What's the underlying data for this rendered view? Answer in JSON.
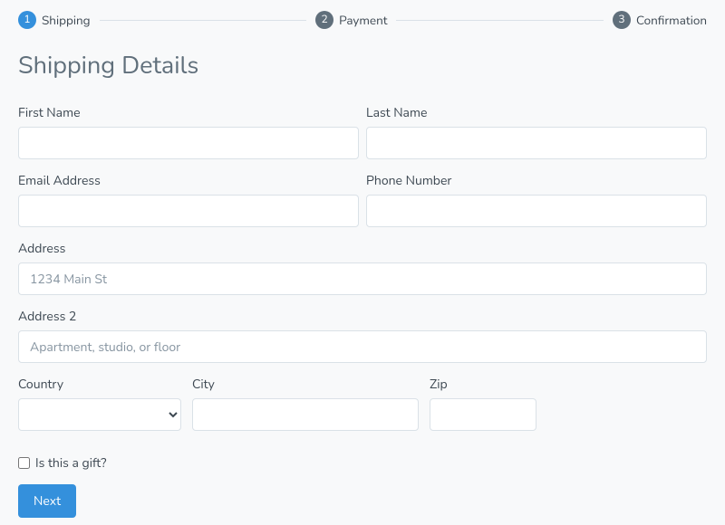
{
  "steps": {
    "s1": {
      "num": "1",
      "label": "Shipping",
      "active": true
    },
    "s2": {
      "num": "2",
      "label": "Payment",
      "active": false
    },
    "s3": {
      "num": "3",
      "label": "Confirmation",
      "active": false
    }
  },
  "title": "Shipping Details",
  "fields": {
    "first_name": {
      "label": "First Name",
      "value": ""
    },
    "last_name": {
      "label": "Last Name",
      "value": ""
    },
    "email": {
      "label": "Email Address",
      "value": ""
    },
    "phone": {
      "label": "Phone Number",
      "value": ""
    },
    "address": {
      "label": "Address",
      "placeholder": "1234 Main St",
      "value": ""
    },
    "address2": {
      "label": "Address 2",
      "placeholder": "Apartment, studio, or floor",
      "value": ""
    },
    "country": {
      "label": "Country",
      "value": ""
    },
    "city": {
      "label": "City",
      "value": ""
    },
    "zip": {
      "label": "Zip",
      "value": ""
    }
  },
  "gift_checkbox": {
    "label": "Is this a gift?",
    "checked": false
  },
  "next_button": "Next"
}
